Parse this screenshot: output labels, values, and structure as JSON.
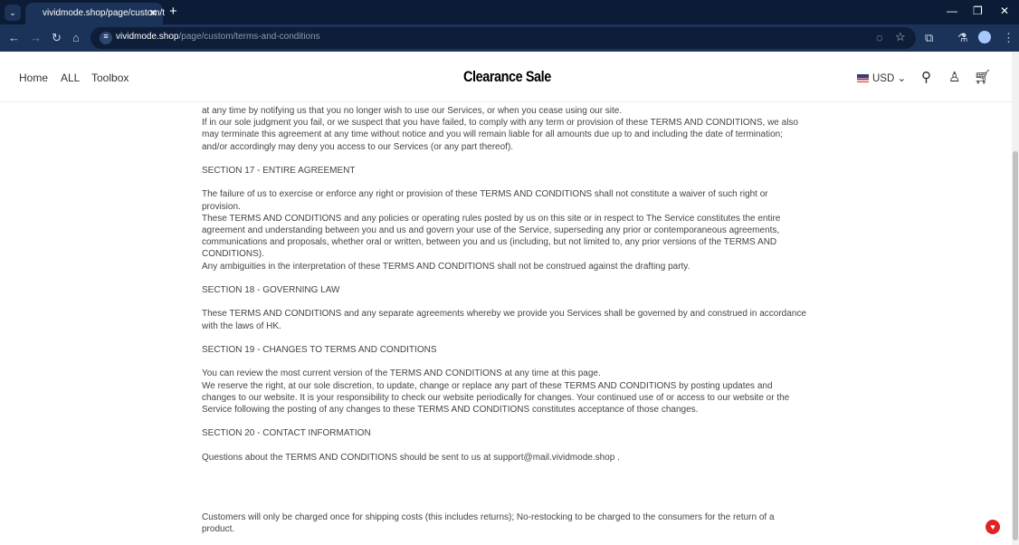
{
  "browser": {
    "tab_title": "vividmode.shop/page/custom/t",
    "url_host": "vividmode.shop",
    "url_path": "/page/custom/terms-and-conditions"
  },
  "nav": {
    "items": [
      "Home",
      "ALL",
      "Toolbox"
    ]
  },
  "logo": "Clearance Sale",
  "currency": "USD",
  "content": {
    "paragraphs": [
      "at any time by notifying us that you no longer wish to use our Services, or when you cease using our site.\nIf in our sole judgment you fail, or we suspect that you have failed, to comply with any term or provision of these TERMS AND CONDITIONS, we also may terminate this agreement at any time without notice and you will remain liable for all amounts due up to and including the date of termination; and/or accordingly may deny you access to our Services (or any part thereof).",
      "SECTION 17 - ENTIRE AGREEMENT",
      "The failure of us to exercise or enforce any right or provision of these TERMS AND CONDITIONS shall not constitute a waiver of such right or provision.\nThese TERMS AND CONDITIONS and any policies or operating rules posted by us on this site or in respect to The Service constitutes the entire agreement and understanding between you and us and govern your use of the Service, superseding any prior or contemporaneous agreements, communications and proposals, whether oral or written, between you and us (including, but not limited to, any prior versions of the TERMS AND CONDITIONS).\nAny ambiguities in the interpretation of these TERMS AND CONDITIONS shall not be construed against the drafting party.",
      "SECTION 18 - GOVERNING LAW",
      "These TERMS AND CONDITIONS and any separate agreements whereby we provide you Services shall be governed by and construed in accordance with the laws of HK.",
      "SECTION 19 - CHANGES TO TERMS AND CONDITIONS",
      "You can review the most current version of the TERMS AND CONDITIONS at any time at this page.\nWe reserve the right, at our sole discretion, to update, change or replace any part of these TERMS AND CONDITIONS by posting updates and changes to our website. It is your responsibility to check our website periodically for changes. Your continued use of or access to our website or the Service following the posting of any changes to these TERMS AND CONDITIONS constitutes acceptance of those changes.",
      "SECTION 20 - CONTACT INFORMATION",
      "Questions about the TERMS AND CONDITIONS should be sent to us at support@mail.vividmode.shop ."
    ],
    "footer_note": "Customers will only be charged once for shipping costs (this includes returns); No-restocking to be charged to the consumers for the return of a product."
  }
}
